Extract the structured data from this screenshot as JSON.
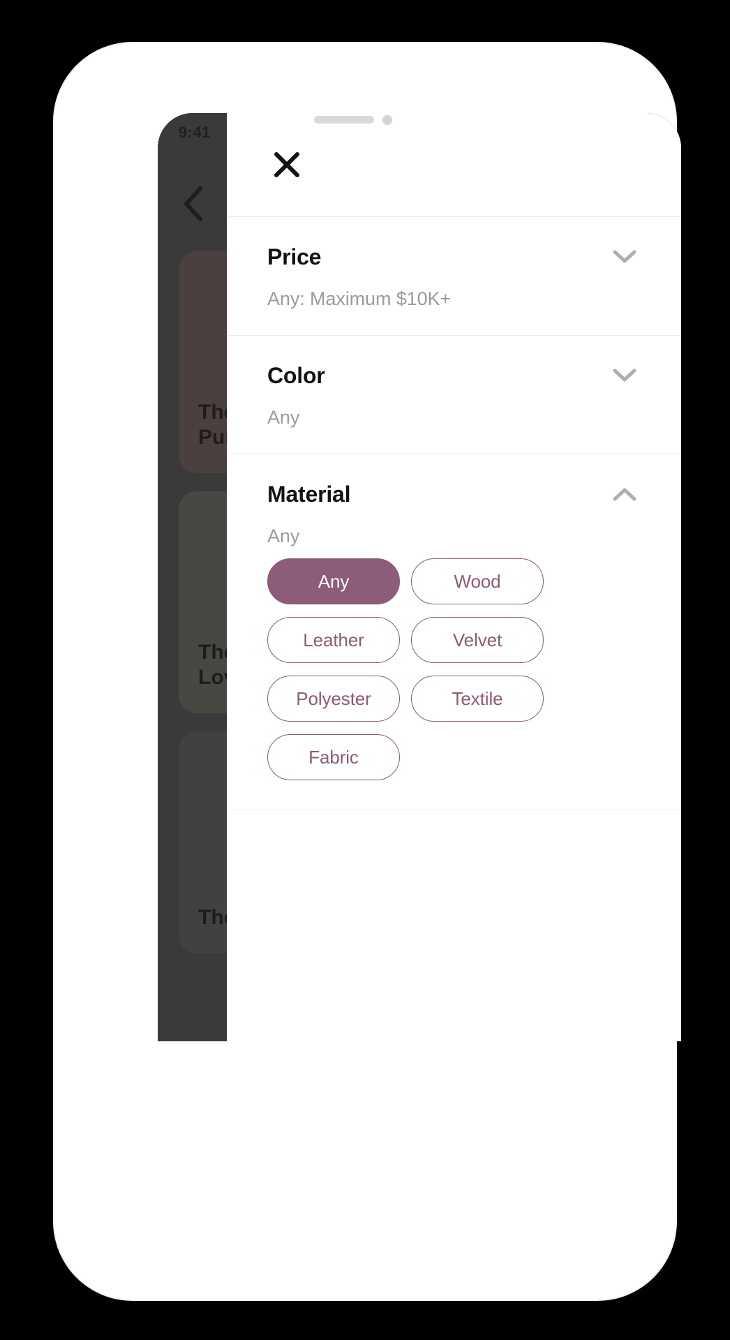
{
  "status_bar": {
    "time": "9:41"
  },
  "background_app": {
    "back_icon": "chevron-left-icon",
    "cards": [
      {
        "title": "The\nPurple",
        "sofa": "red-sofa"
      },
      {
        "title": "The\nLoveseat",
        "sofa": "brown-sofa"
      },
      {
        "title": "The",
        "sofa": "dark-sofa"
      }
    ]
  },
  "filter_sheet": {
    "close_icon": "close-icon",
    "sections": [
      {
        "title": "Price",
        "value": "Any: Maximum $10K+",
        "expanded": false,
        "chevron_icon": "chevron-down-icon",
        "options": []
      },
      {
        "title": "Color",
        "value": "Any",
        "expanded": false,
        "chevron_icon": "chevron-down-icon",
        "options": []
      },
      {
        "title": "Material",
        "value": "Any",
        "expanded": true,
        "chevron_icon": "chevron-up-icon",
        "options": [
          {
            "label": "Any",
            "selected": true
          },
          {
            "label": "Wood",
            "selected": false
          },
          {
            "label": "Leather",
            "selected": false
          },
          {
            "label": "Velvet",
            "selected": false
          },
          {
            "label": "Polyester",
            "selected": false
          },
          {
            "label": "Textile",
            "selected": false
          },
          {
            "label": "Fabric",
            "selected": false
          }
        ]
      }
    ]
  },
  "colors": {
    "accent": "#8d5c79",
    "accent_outline": "#8e5a76",
    "heading": "#131313",
    "muted_text": "#9b9b9b",
    "divider": "#eaeaea",
    "scrim": "#4f4f4f",
    "sheet_bg": "#ffffff",
    "device_body": "#ffffff",
    "page_bg": "#000000"
  }
}
